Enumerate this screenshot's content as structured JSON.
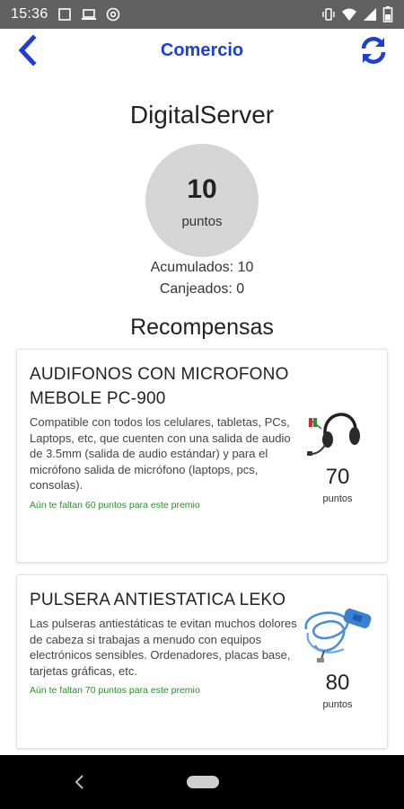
{
  "status_bar": {
    "time": "15:36",
    "icons": [
      "notification-icon",
      "laptop-icon",
      "at-sign-icon",
      "vibrate-icon",
      "wifi-icon",
      "signal-icon",
      "battery-icon"
    ]
  },
  "header": {
    "title": "Comercio",
    "back_icon": "chevron-left-icon",
    "refresh_icon": "refresh-icon",
    "accent_color": "#1d3ed8"
  },
  "merchant": {
    "name": "DigitalServer",
    "points": "10",
    "points_unit": "puntos",
    "accumulated": "Acumulados: 10",
    "redeemed": "Canjeados: 0"
  },
  "rewards": {
    "section_title": "Recompensas",
    "items": [
      {
        "title": "AUDIFONOS CON MICROFONO MEBOLE PC-900",
        "description": "Compatible con todos los celulares, tabletas, PCs, Laptops, etc, que cuenten con una salida de audio de 3.5mm (salida de audio estándar) y para el micrófono salida de micrófono (laptops, pcs, consolas).",
        "missing": "Aún te faltan 60 puntos para este premio",
        "points": "70",
        "points_unit": "puntos",
        "image_icon": "headset-icon"
      },
      {
        "title": "PULSERA ANTIESTATICA LEKO",
        "description": "Las pulseras antiestáticas te evitan muchos dolores de cabeza si trabajas a menudo con equipos electrónicos sensibles. Ordenadores, placas base, tarjetas gráficas, etc.",
        "missing": "Aún te faltan 70 puntos para este premio",
        "points": "80",
        "points_unit": "puntos",
        "image_icon": "antistatic-wristband-icon"
      }
    ]
  },
  "colors": {
    "status_bar": "#616161",
    "missing_text": "#2e8b2e",
    "circle": "#d5d5d5"
  }
}
